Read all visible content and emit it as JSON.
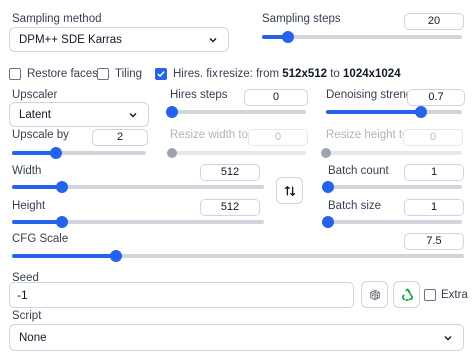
{
  "sampling": {
    "method_label": "Sampling method",
    "method_value": "DPM++ SDE Karras",
    "steps_label": "Sampling steps",
    "steps_value": "20",
    "steps_fraction": 0.13
  },
  "options": {
    "restore_faces": {
      "label": "Restore faces",
      "checked": false
    },
    "tiling": {
      "label": "Tiling",
      "checked": false
    },
    "hires_fix": {
      "label": "Hires. fix",
      "checked": true
    },
    "resize_prefix": "resize: from ",
    "resize_from": "512x512",
    "resize_to_word": " to ",
    "resize_to": "1024x1024"
  },
  "hires": {
    "upscaler_label": "Upscaler",
    "upscaler_value": "Latent",
    "steps_label": "Hires steps",
    "steps_value": "0",
    "steps_fraction": 0.0,
    "denoise_label": "Denoising strength",
    "denoise_value": "0.7",
    "denoise_fraction": 0.7,
    "upscale_label": "Upscale by",
    "upscale_value": "2",
    "upscale_fraction": 0.33,
    "resize_w_label": "Resize width to",
    "resize_w_value": "0",
    "resize_h_label": "Resize height to",
    "resize_h_value": "0"
  },
  "size": {
    "width_label": "Width",
    "width_value": "512",
    "width_fraction": 0.2,
    "height_label": "Height",
    "height_value": "512",
    "height_fraction": 0.2,
    "swap_icon": "swap-arrows-icon"
  },
  "batch": {
    "count_label": "Batch count",
    "count_value": "1",
    "count_fraction": 0.0,
    "size_label": "Batch size",
    "size_value": "1",
    "size_fraction": 0.0
  },
  "cfg": {
    "label": "CFG Scale",
    "value": "7.5",
    "fraction": 0.23
  },
  "seed": {
    "label": "Seed",
    "value": "-1",
    "dice_icon": "dice-icon",
    "recycle_icon": "recycle-icon",
    "extra_label": "Extra",
    "extra_checked": false
  },
  "script": {
    "label": "Script",
    "value": "None"
  },
  "colors": {
    "accent": "#2563eb",
    "track": "#d1d5db",
    "recycle": "#16a34a"
  }
}
